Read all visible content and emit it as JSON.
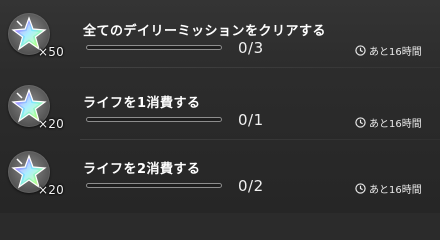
{
  "missions": [
    {
      "title": "全てのデイリーミッションをクリアする",
      "reward_icon": "rainbow-star-crystal-icon",
      "reward_qty": "×50",
      "progress_current": 0,
      "progress_total": 3,
      "progress_text": "0/3",
      "time_left": "あと16時間"
    },
    {
      "title": "ライフを1消費する",
      "reward_icon": "rainbow-star-crystal-icon",
      "reward_qty": "×20",
      "progress_current": 0,
      "progress_total": 1,
      "progress_text": "0/1",
      "time_left": "あと16時間"
    },
    {
      "title": "ライフを2消費する",
      "reward_icon": "rainbow-star-crystal-icon",
      "reward_qty": "×20",
      "progress_current": 0,
      "progress_total": 2,
      "progress_text": "0/2",
      "time_left": "あと16時間"
    }
  ],
  "colors": {
    "background": "#2c2c2c",
    "text": "#ffffff",
    "progress_border": "#8d8d8d",
    "progress_track": "#1e1e1e"
  }
}
